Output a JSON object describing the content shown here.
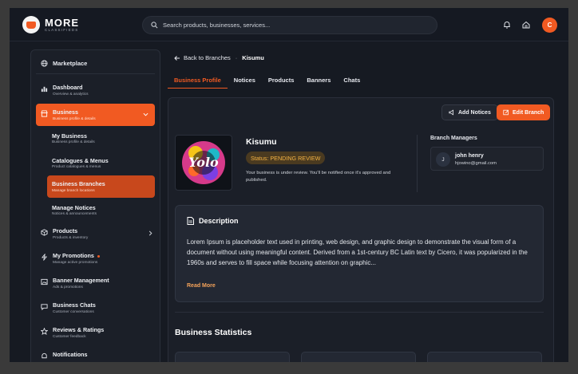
{
  "app": {
    "logo_main": "MORE",
    "logo_sub": "CLASSIFIEDS",
    "search_placeholder": "Search products, businesses, services...",
    "avatar_initial": "C"
  },
  "sidebar": {
    "marketplace": "Marketplace",
    "items": [
      {
        "label": "Dashboard",
        "sub": "Overview & analytics"
      },
      {
        "label": "Business",
        "sub": "Business profile & details"
      },
      {
        "label": "Products",
        "sub": "Products & inventory"
      },
      {
        "label": "My Promotions",
        "sub": "Manage active promotions"
      },
      {
        "label": "Banner Management",
        "sub": "Ads & promotions"
      },
      {
        "label": "Business Chats",
        "sub": "Customer conversations"
      },
      {
        "label": "Reviews & Ratings",
        "sub": "Customer feedback"
      },
      {
        "label": "Notifications",
        "sub": ""
      }
    ],
    "business_sub": [
      {
        "label": "My Business",
        "sub": "Business profile & details"
      },
      {
        "label": "Catalogues & Menus",
        "sub": "Product catalogues & menus"
      },
      {
        "label": "Business Branches",
        "sub": "Manage branch locations"
      },
      {
        "label": "Manage Notices",
        "sub": "Notices & announcements"
      }
    ]
  },
  "breadcrumb": {
    "back": "Back to Branches",
    "current": "Kisumu"
  },
  "tabs": [
    "Business Profile",
    "Notices",
    "Products",
    "Banners",
    "Chats"
  ],
  "profile": {
    "add_notices": "Add Notices",
    "edit_branch": "Edit Branch",
    "name": "Kisumu",
    "status": "Status: PENDING REVIEW",
    "note": "Your business is under review. You'll be notified once it's approved and published.",
    "managers_title": "Branch Managers",
    "manager_initial": "J",
    "manager_name": "john henry",
    "manager_email": "hjowino@gmail.com",
    "logo_text": "Yolo"
  },
  "description": {
    "title": "Description",
    "text": "Lorem Ipsum is placeholder text used in printing, web design, and graphic design to demonstrate the visual form of a document without using meaningful content. Derived from a 1st-century BC Latin text by Cicero, it was popularized in the 1960s and serves to fill space while focusing attention on graphic...",
    "read_more": "Read More"
  },
  "stats": {
    "title": "Business Statistics"
  },
  "colors": {
    "accent": "#f15a22",
    "status_text": "#f5b342",
    "background": "#161a22"
  }
}
